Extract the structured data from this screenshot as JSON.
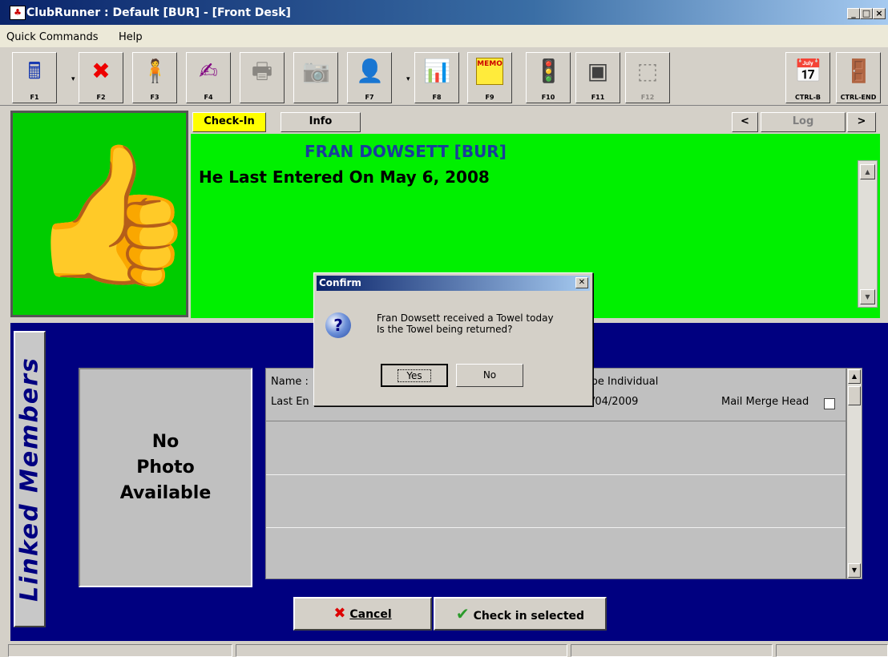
{
  "window": {
    "title": "ClubRunner : Default [BUR] - [Front Desk]",
    "icon": "clubrunner-app-icon",
    "min": "_",
    "max": "□",
    "close": "×"
  },
  "menu": {
    "items": [
      "Quick Commands",
      "Help"
    ]
  },
  "toolbar": {
    "buttons": [
      {
        "key": "F1",
        "icon": "cash-register-icon",
        "glyph": "🖩"
      },
      {
        "key": "F2",
        "icon": "no-card-icon",
        "glyph": "✖"
      },
      {
        "key": "F3",
        "icon": "person-icon",
        "glyph": "🧍"
      },
      {
        "key": "F4",
        "icon": "sign-document-icon",
        "glyph": "✍"
      },
      {
        "key": "",
        "icon": "printer-icon",
        "glyph": "🖶"
      },
      {
        "key": "",
        "icon": "camera-icon",
        "glyph": "📷"
      },
      {
        "key": "F7",
        "icon": "member-search-icon",
        "glyph": "👤"
      },
      {
        "key": "F8",
        "icon": "report-chart-icon",
        "glyph": "📊"
      },
      {
        "key": "F9",
        "icon": "memo-icon",
        "glyph": "MEMO"
      },
      {
        "key": "F10",
        "icon": "traffic-light-icon",
        "glyph": "🚦"
      },
      {
        "key": "F11",
        "icon": "safe-icon",
        "glyph": "▣"
      },
      {
        "key": "F12",
        "icon": "door-icon",
        "glyph": "⬚"
      },
      {
        "key": "CTRL-B",
        "icon": "calendar-edit-icon",
        "glyph": "📅"
      },
      {
        "key": "CTRL-END",
        "icon": "exit-door-icon",
        "glyph": "🚪"
      }
    ],
    "dropdown": "▾"
  },
  "status_panel": {
    "icon": "thumbs-up-icon",
    "glyph": "👍",
    "color": "#00cc00"
  },
  "tabs": {
    "checkin": "Check-In",
    "info": "Info"
  },
  "nav": {
    "prev": "<",
    "log": "Log",
    "next": ">"
  },
  "member": {
    "name": "FRAN DOWSETT [BUR]",
    "last_entered": "He Last Entered On May 6, 2008"
  },
  "linked": {
    "label": "Linked Members",
    "photo": {
      "line1": "No",
      "line2": "Photo",
      "line3": "Available"
    },
    "grid": {
      "name_label": "Name :",
      "type_text": "Type Individual",
      "last_label": "Last En",
      "date_text": "/04/2009",
      "mail_merge": "Mail Merge Head"
    }
  },
  "buttons": {
    "cancel": "Cancel",
    "checkin": "Check in selected"
  },
  "dialog": {
    "title": "Confirm",
    "line1": "Fran Dowsett received a Towel today",
    "line2": "Is the Towel being returned?",
    "yes": "Yes",
    "no": "No",
    "icon": "question-icon"
  }
}
